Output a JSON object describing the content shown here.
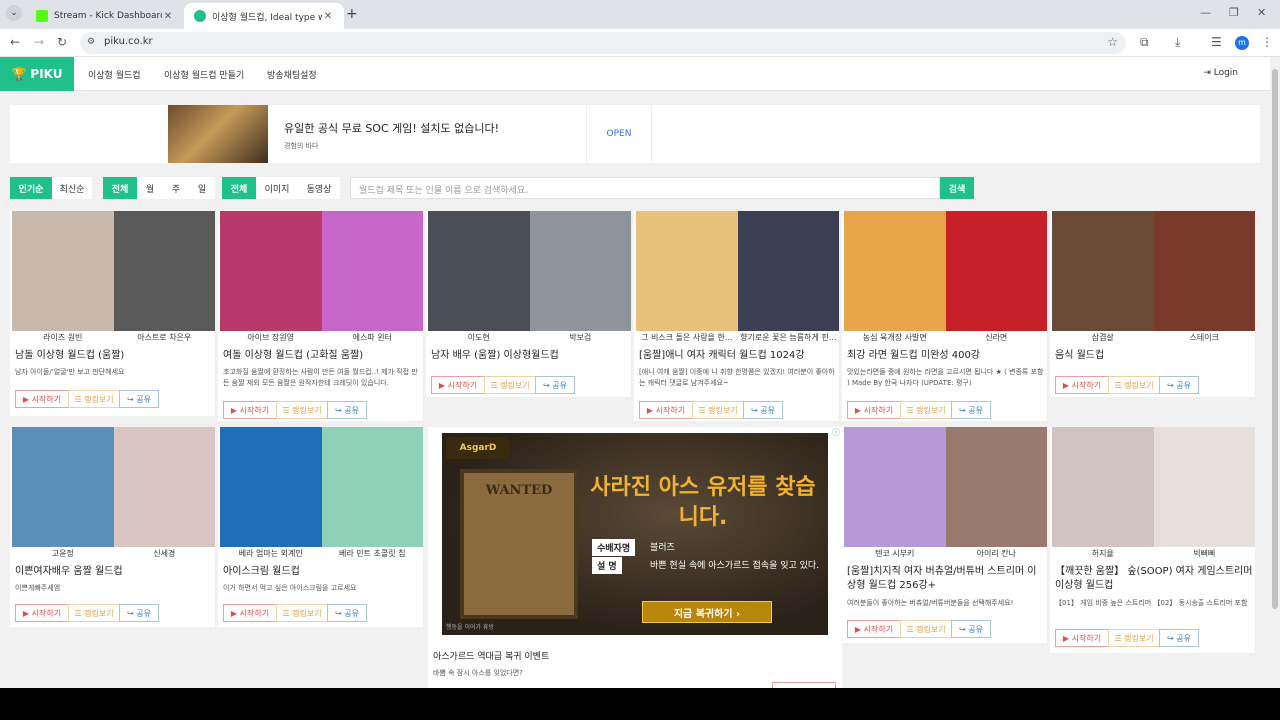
{
  "browser": {
    "tabs": [
      {
        "title": "Stream - Kick Dashboard",
        "favicon_color": "#53fc18"
      },
      {
        "title": "이상형 월드컵, Ideal type worl",
        "favicon_color": "#1fc08a"
      }
    ],
    "url": "piku.co.kr",
    "profile_initial": "m"
  },
  "nav": {
    "brand": "PIKU",
    "links": [
      "이상형 월드컵",
      "이상형 월드컵 만들기",
      "방송채팅설정"
    ],
    "login": "Login"
  },
  "banner_ad": {
    "title": "유일한 공식 무료 SOC 게임! 설치도 없습니다!",
    "subtitle": "경험의 바다",
    "open_label": "OPEN"
  },
  "filters": {
    "sort": [
      "인기순",
      "최신순"
    ],
    "period": [
      "전체",
      "월",
      "주",
      "일"
    ],
    "media": [
      "전체",
      "이미지",
      "동영상"
    ],
    "search_placeholder": "월드컵 제목 또는 인물 이름 으로 검색하세요.",
    "search_button": "검색"
  },
  "buttons": {
    "start": "▶ 시작하기",
    "rank": "☰ 랭킹보기",
    "share": "↪ 공유"
  },
  "cards": [
    {
      "left": "라이즈 원빈",
      "right": "아스트로 차은우",
      "title": "남돌 이상형 월드컵 (움짤)",
      "desc": "남자 아이돌/'얼굴'만 보고 판단해세요",
      "colors": [
        "#c9b9ad",
        "#5a5a5a"
      ]
    },
    {
      "left": "아이브 장원영",
      "right": "에스파 윈터",
      "title": "여돌 이상형 월드컵 (고화질 움짤)",
      "desc": "초고화질 움짤에 환장하는 사람이 만든 여돌 월드컵..! 제가 직접 만든 움짤 제외 모든 움짤은 원작자한테 크레딧이 있습니다.",
      "colors": [
        "#b83a6a",
        "#c766c9"
      ]
    },
    {
      "left": "이도현",
      "right": "박보검",
      "title": "남자 배우 (움짤) 이상형월드컵",
      "desc": "",
      "colors": [
        "#4a4e56",
        "#8e949c"
      ]
    },
    {
      "left": "그 비스크 돌은 사랑을 한...",
      "right": "향기로운 꽃은 늠름하게 핀...",
      "title": "[움짤]애니 여자 캐릭터 월드컵 1024강",
      "desc": "[애니 여캐 움짤] 이중에 니 취향 한명쯤은 있겠지! 여러분이 좋아하는 캐릭터 댓글로 남겨주세요~",
      "colors": [
        "#e8c27a",
        "#3a3f52"
      ]
    },
    {
      "left": "농심 육개장 사발면",
      "right": "신라면",
      "title": "최강 라면 월드컵 미완성 400강",
      "desc": "맛있는라면들 중에 원하는 라면을 고르시면 됩니다 ★ ( 변종류 포함 ) Made By 한국 나자다 (UPDATE: 평구)",
      "colors": [
        "#e9a54a",
        "#c8202a"
      ]
    },
    {
      "left": "삼겹살",
      "right": "스테이크",
      "title": "음식 월드컵",
      "desc": "",
      "colors": [
        "#6a4a36",
        "#7a3a2a"
      ]
    },
    {
      "left": "고윤정",
      "right": "신세경",
      "title": "이쁜여자배우 움짤 월드컵",
      "desc": "이쁜게빠주세엠",
      "colors": [
        "#5b8fb9",
        "#d8c6c2"
      ]
    },
    {
      "left": "베라 엄마는 외계인",
      "right": "베라 민트 초콜릿 칩",
      "title": "아이스크림 월드컵",
      "desc": "이거 하면서 먹고 싶은 아이스크림을 고르세요",
      "colors": [
        "#1f6fb8",
        "#8ed1b8"
      ]
    },
    {
      "left": "텐코 시부키",
      "right": "아이리 칸나",
      "title": "[움짤]치지직 여자 버츄얼/버튜버 스트리머 이상형 월드컵 256강+",
      "desc": "여러분들이 좋아하는 버츄얼/버튜버분들을 선택해주세요!",
      "colors": [
        "#b69ad8",
        "#9a7a6e"
      ]
    },
    {
      "left": "허지율",
      "right": "빅뻐뻐",
      "title": "【깨끗한 움짤】 숲(SOOP) 여자 게임스트리머 이상형 월드컵",
      "desc": "【01】 게임 비중 높은 스트리머 【02】 동시송출 스트리머 포함",
      "colors": [
        "#cfc4c2",
        "#e6e0dc"
      ]
    }
  ],
  "big_ad": {
    "logo": "AsgarD",
    "wanted": "WANTED",
    "headline": "사라진 아스 유저를 찾습니다.",
    "tag1": "수배자명",
    "tag2": "설 명",
    "tag1_value": "블러즈",
    "tag2_value": "바쁜 현실 속에 아스가르드 접속을 잊고 있다.",
    "cta": "지금 복귀하기 ›",
    "fine": "행동을 이어가 휴방",
    "title": "아스가르드 역대급 복귀 이벤트",
    "subtitle": "바쁨 속 잠시 아스를 잊었다면?"
  }
}
